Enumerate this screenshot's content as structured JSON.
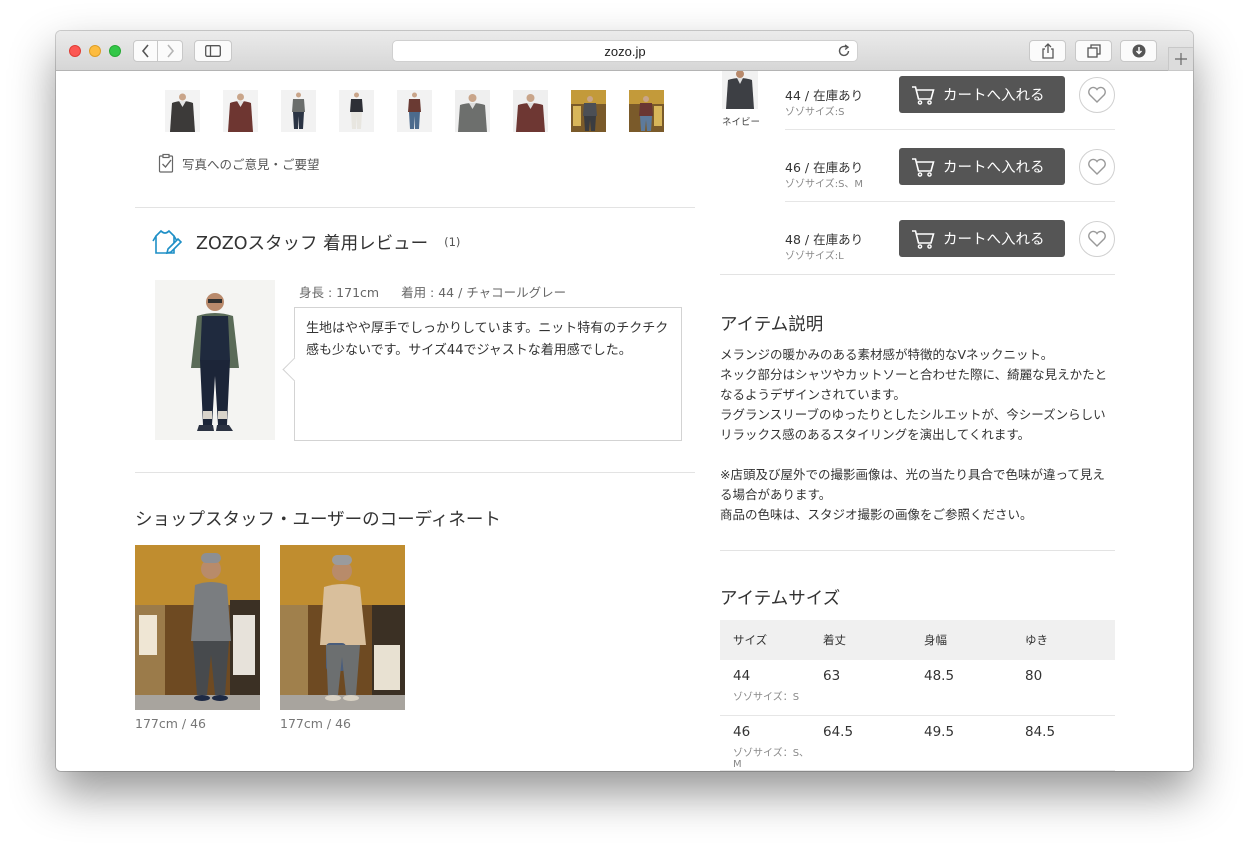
{
  "browser": {
    "url": "zozo.jp"
  },
  "gallery": {
    "thumbnails": [
      {
        "color": "charcoal"
      },
      {
        "color": "burgundy"
      },
      {
        "color": "gray-full"
      },
      {
        "color": "navy-full"
      },
      {
        "color": "denim-full"
      },
      {
        "color": "gray-close"
      },
      {
        "color": "burgundy-close"
      },
      {
        "color": "street-1"
      },
      {
        "color": "street-2"
      }
    ],
    "feedback_label": "写真へのご意見・ご要望"
  },
  "review": {
    "title": "ZOZOスタッフ 着用レビュー",
    "count": "(1)",
    "height": "身長 : 171cm",
    "wearing": "着用 : 44 / チャコールグレー",
    "comment": "生地はやや厚手でしっかりしています。ニット特有のチクチク感も少ないです。サイズ44でジャストな着用感でした。"
  },
  "coordinate": {
    "title": "ショップスタッフ・ユーザーのコーディネート",
    "items": [
      {
        "caption": "177cm / 46"
      },
      {
        "caption": "177cm / 46"
      }
    ]
  },
  "variant": {
    "color_label": "ネイビー",
    "sizes": [
      {
        "name": "44 / 在庫あり",
        "zozo": "ゾゾサイズ:S",
        "cart_label": "カートへ入れる"
      },
      {
        "name": "46 / 在庫あり",
        "zozo": "ゾゾサイズ:S、M",
        "cart_label": "カートへ入れる"
      },
      {
        "name": "48 / 在庫あり",
        "zozo": "ゾゾサイズ:L",
        "cart_label": "カートへ入れる"
      }
    ]
  },
  "description": {
    "title": "アイテム説明",
    "lines": [
      "メランジの暖かみのある素材感が特徴的なVネックニット。",
      "ネック部分はシャツやカットソーと合わせた際に、綺麗な見えかたとなるようデザインされています。",
      "ラグランスリーブのゆったりとしたシルエットが、今シーズンらしいリラックス感のあるスタイリングを演出してくれます。"
    ],
    "notes": [
      "※店頭及び屋外での撮影画像は、光の当たり具合で色味が違って見える場合があります。",
      "商品の色味は、スタジオ撮影の画像をご参照ください。"
    ]
  },
  "size_table": {
    "title": "アイテムサイズ",
    "headers": [
      "サイズ",
      "着丈",
      "身幅",
      "ゆき"
    ],
    "rows": [
      {
        "size": "44",
        "zozo": "ゾゾサイズ：S",
        "length": "63",
        "width": "48.5",
        "sleeve": "80"
      },
      {
        "size": "46",
        "zozo": "ゾゾサイズ：S、M",
        "length": "64.5",
        "width": "49.5",
        "sleeve": "84.5"
      }
    ]
  },
  "colors": {
    "cart_button": "#555555",
    "review_icon": "#1e8fc6"
  }
}
